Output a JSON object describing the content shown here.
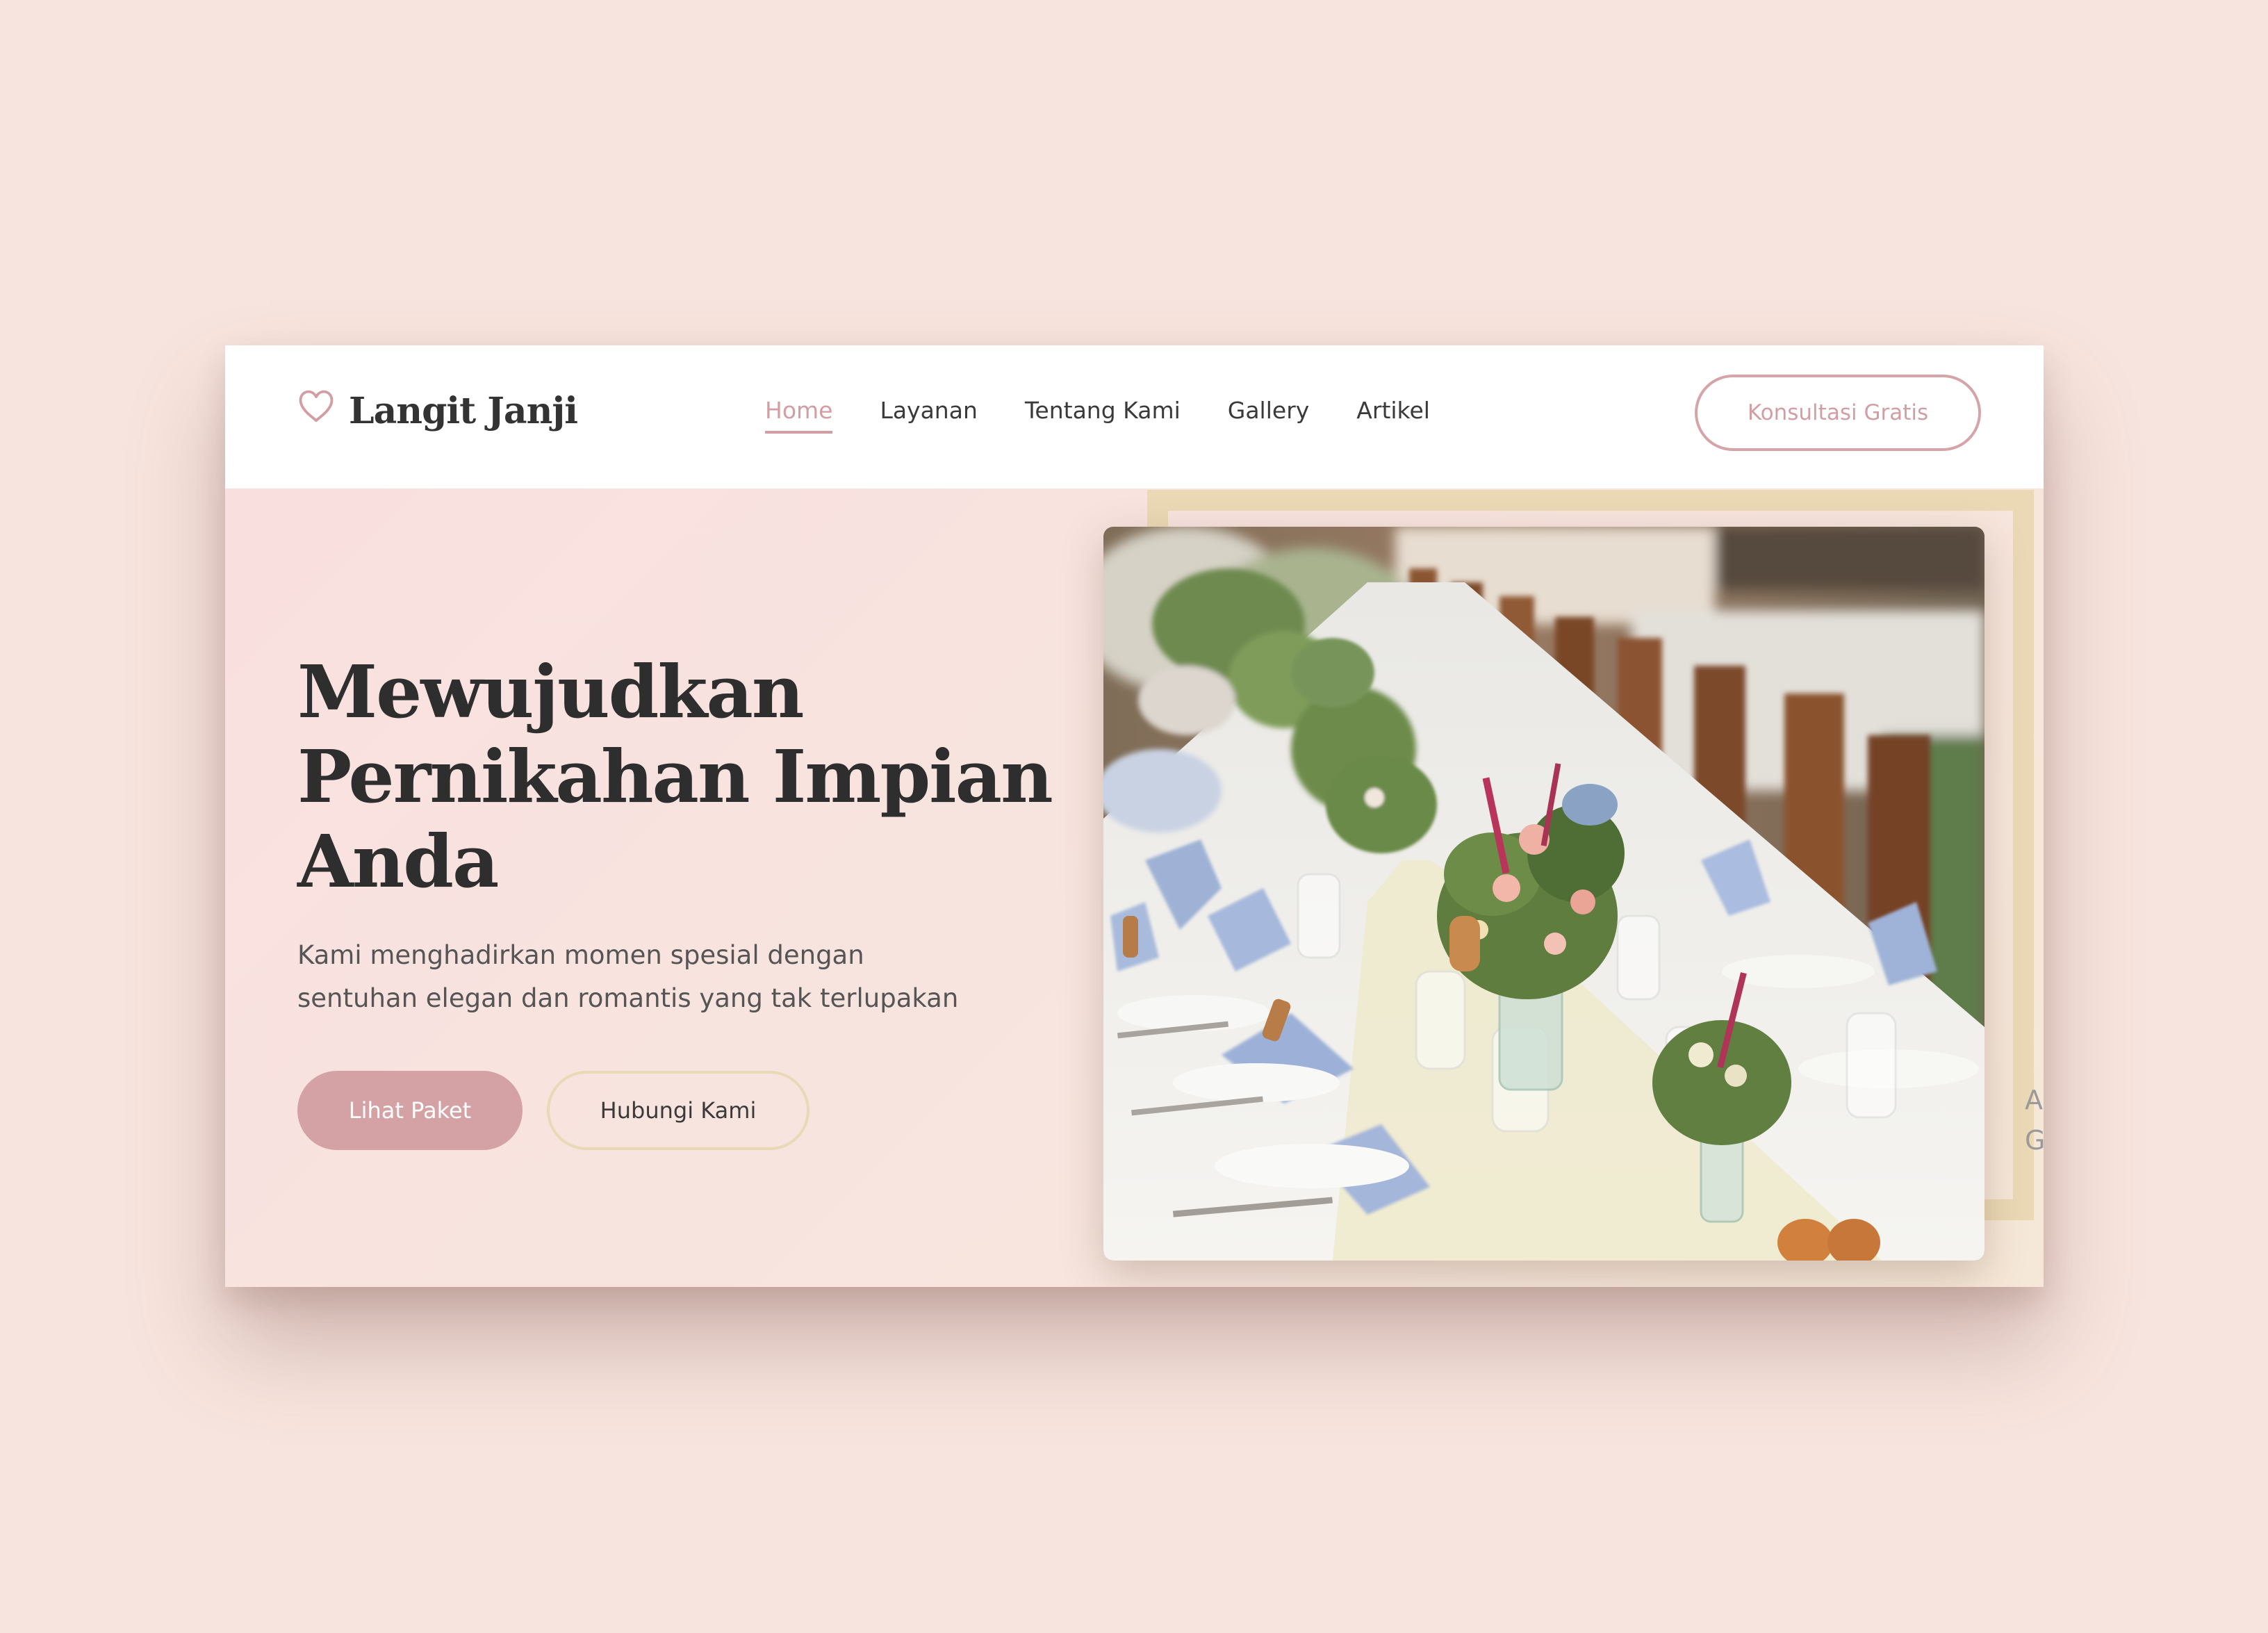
{
  "brand": {
    "name": "Langit Janji",
    "icon": "heart-outline-icon",
    "accent_color": "#d39ea3"
  },
  "nav": {
    "items": [
      {
        "label": "Home",
        "active": true
      },
      {
        "label": "Layanan",
        "active": false
      },
      {
        "label": "Tentang Kami",
        "active": false
      },
      {
        "label": "Gallery",
        "active": false
      },
      {
        "label": "Artikel",
        "active": false
      }
    ],
    "cta_label": "Konsultasi Gratis"
  },
  "hero": {
    "title_lines": [
      "Mewujudkan",
      "Pernikahan Impian",
      "Anda"
    ],
    "subtitle_lines": [
      "Kami menghadirkan momen spesial dengan",
      "sentuhan elegan dan romantis yang tak terlupakan"
    ],
    "primary_button": "Lihat Paket",
    "secondary_button": "Hubungi Kami",
    "cutoff_letters": [
      "A",
      "G"
    ]
  },
  "colors": {
    "page_background": "#f8e4de",
    "primary_button": "#d4a2a5",
    "frame_gold": "#ebd9b5",
    "heading": "#2e2e2e"
  }
}
